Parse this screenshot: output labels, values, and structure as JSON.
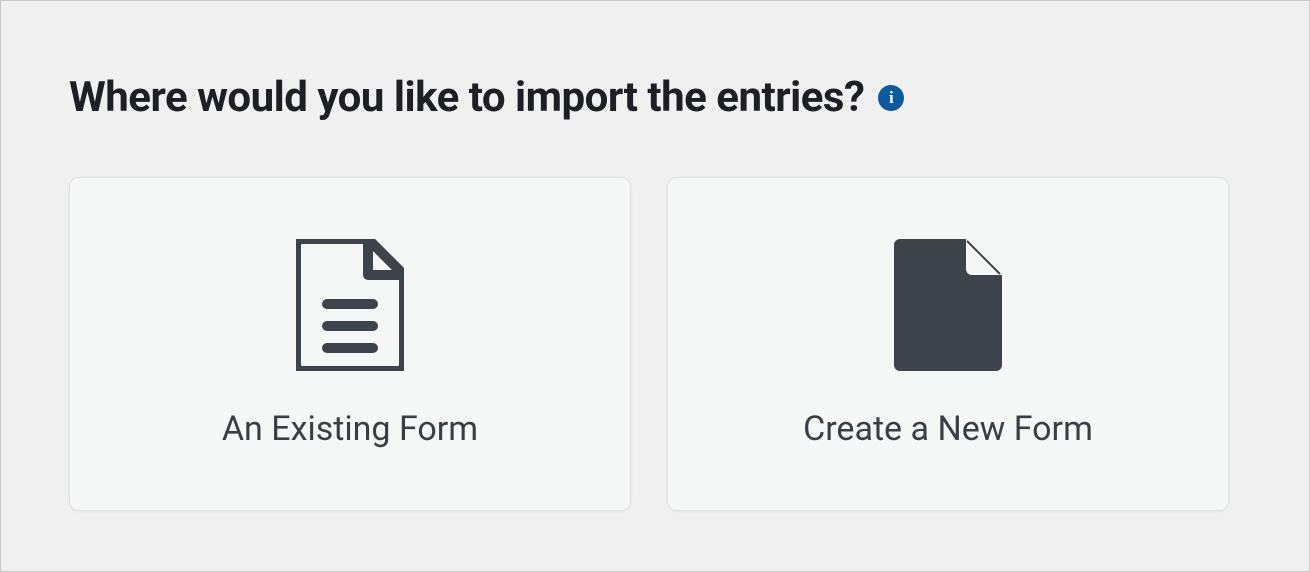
{
  "heading": "Where would you like to import the entries?",
  "info_glyph": "i",
  "colors": {
    "info_bg": "#0b5aa0",
    "icon_dark": "#3c434a",
    "text_heading": "#1d1f24",
    "text_label": "#3a3d44",
    "card_bg": "#f6f7f7"
  },
  "options": [
    {
      "label": "An Existing Form",
      "icon": "document-text"
    },
    {
      "label": "Create a New Form",
      "icon": "document-blank"
    }
  ]
}
